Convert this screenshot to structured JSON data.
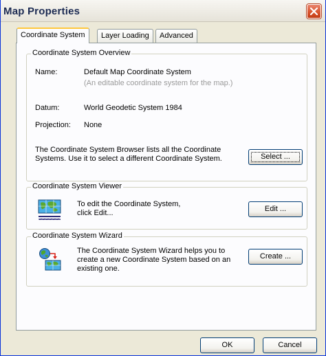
{
  "window": {
    "title": "Map Properties"
  },
  "tabs": [
    {
      "label": "Coordinate System"
    },
    {
      "label": "Layer Loading"
    },
    {
      "label": "Advanced"
    }
  ],
  "overview": {
    "legend": "Coordinate System Overview",
    "name_label": "Name:",
    "name_value": "Default Map Coordinate System",
    "name_hint": "(An editable coordinate system for the map.)",
    "datum_label": "Datum:",
    "datum_value": "World Geodetic System 1984",
    "projection_label": "Projection:",
    "projection_value": "None",
    "browser_text_line1": "The Coordinate System Browser lists all the Coordinate",
    "browser_text_line2": "Systems.  Use it to select a different Coordinate System.",
    "select_button": "Select ..."
  },
  "viewer": {
    "legend": "Coordinate System Viewer",
    "text_line1": "To edit the Coordinate System,",
    "text_line2": "click Edit...",
    "edit_button": "Edit ...",
    "icon": "map-grid-icon"
  },
  "wizard": {
    "legend": "Coordinate System Wizard",
    "text_line1": "The Coordinate System Wizard helps you to",
    "text_line2": "create a new Coordinate System based on an",
    "text_line3": "existing one.",
    "create_button": "Create ...",
    "icon": "globe-to-map-icon"
  },
  "footer": {
    "ok_button": "OK",
    "cancel_button": "Cancel"
  }
}
